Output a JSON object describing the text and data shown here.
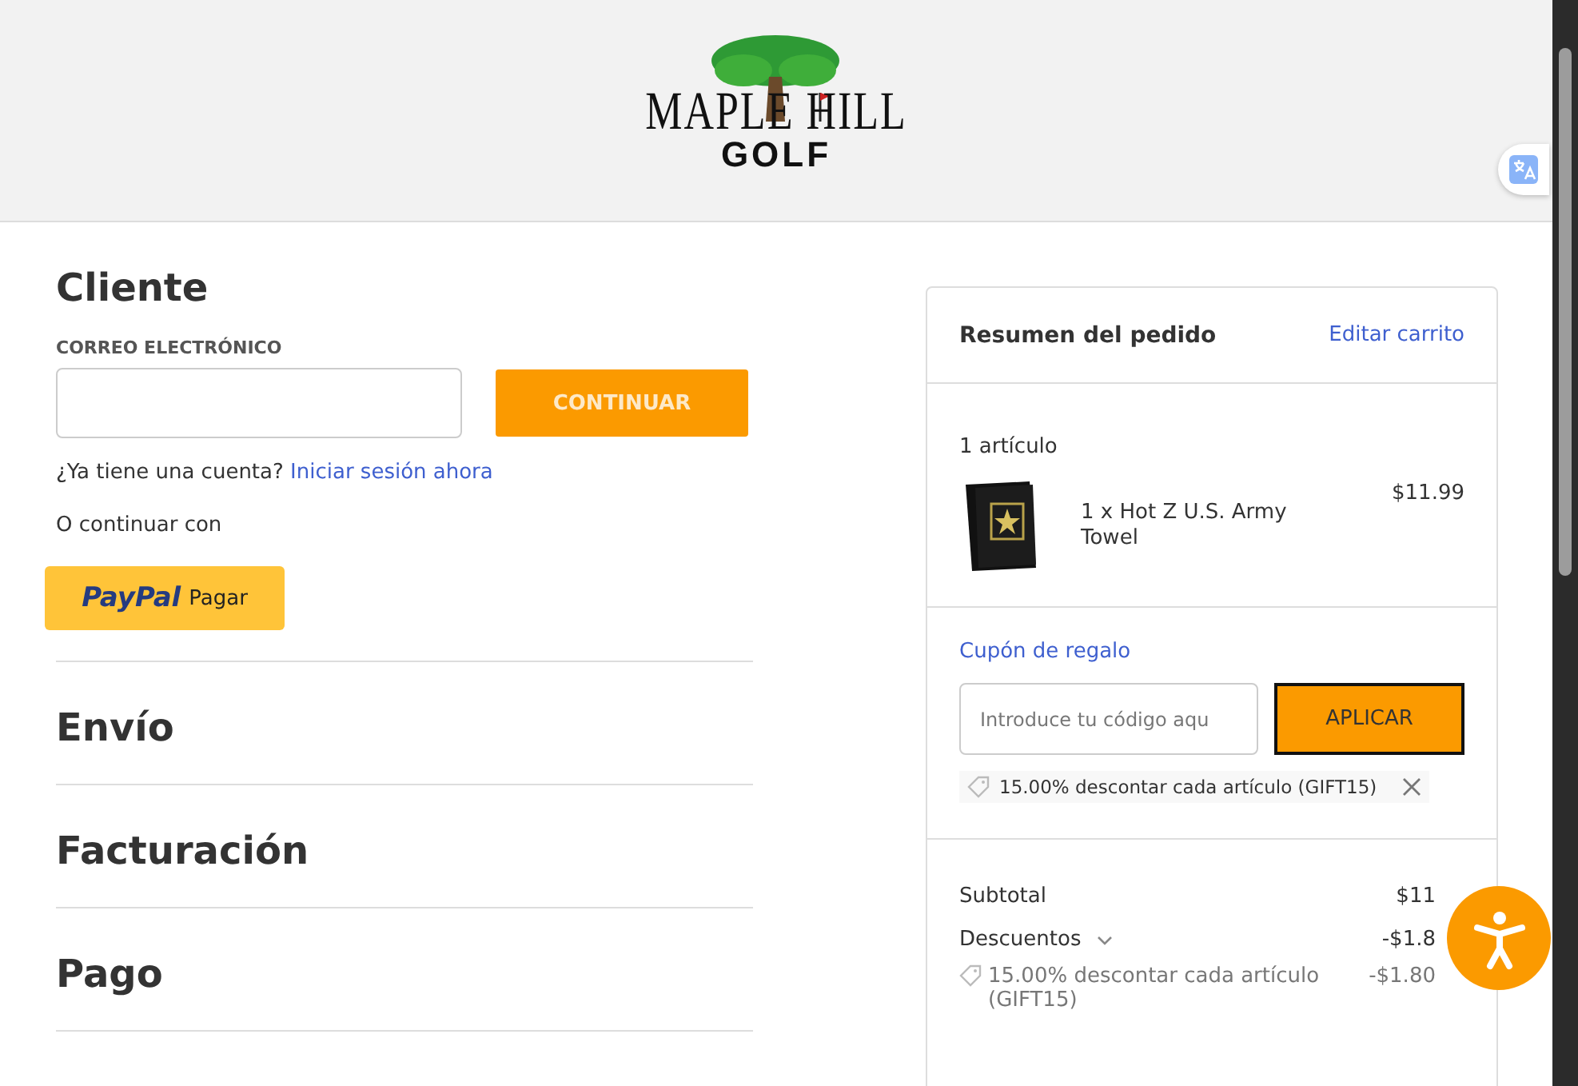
{
  "header": {
    "logo": {
      "line1": "MAPLE HILL",
      "line2": "GOLF"
    }
  },
  "customer": {
    "title": "Cliente",
    "email_label": "CORREO ELECTRÓNICO",
    "continue_button": "CONTINUAR",
    "account_prompt": "¿Ya tiene una cuenta?",
    "sign_in_link": "Iniciar sesión ahora",
    "alt_text": "O continuar con",
    "paypal": {
      "brand": "PayPal",
      "label": "Pagar"
    }
  },
  "steps": [
    {
      "title": "Envío"
    },
    {
      "title": "Facturación"
    },
    {
      "title": "Pago"
    }
  ],
  "summary": {
    "title": "Resumen del pedido",
    "edit_link": "Editar carrito",
    "item_count": "1 artículo",
    "items": [
      {
        "name": "1 x Hot Z U.S. Army Towel",
        "price": "$11.99"
      }
    ],
    "coupon": {
      "link": "Cupón de regalo",
      "placeholder": "Introduce tu código aqu",
      "apply_button": "APLICAR",
      "applied": "15.00% descontar cada artículo (GIFT15)"
    },
    "totals": [
      {
        "kind": "line",
        "label": "Subtotal",
        "value": "$11"
      },
      {
        "kind": "expandable",
        "label": "Descuentos",
        "value": "-$1.8",
        "expanded": true
      },
      {
        "kind": "detail",
        "label": "15.00% descontar cada artículo (GIFT15)",
        "value": "-$1.80"
      }
    ]
  }
}
